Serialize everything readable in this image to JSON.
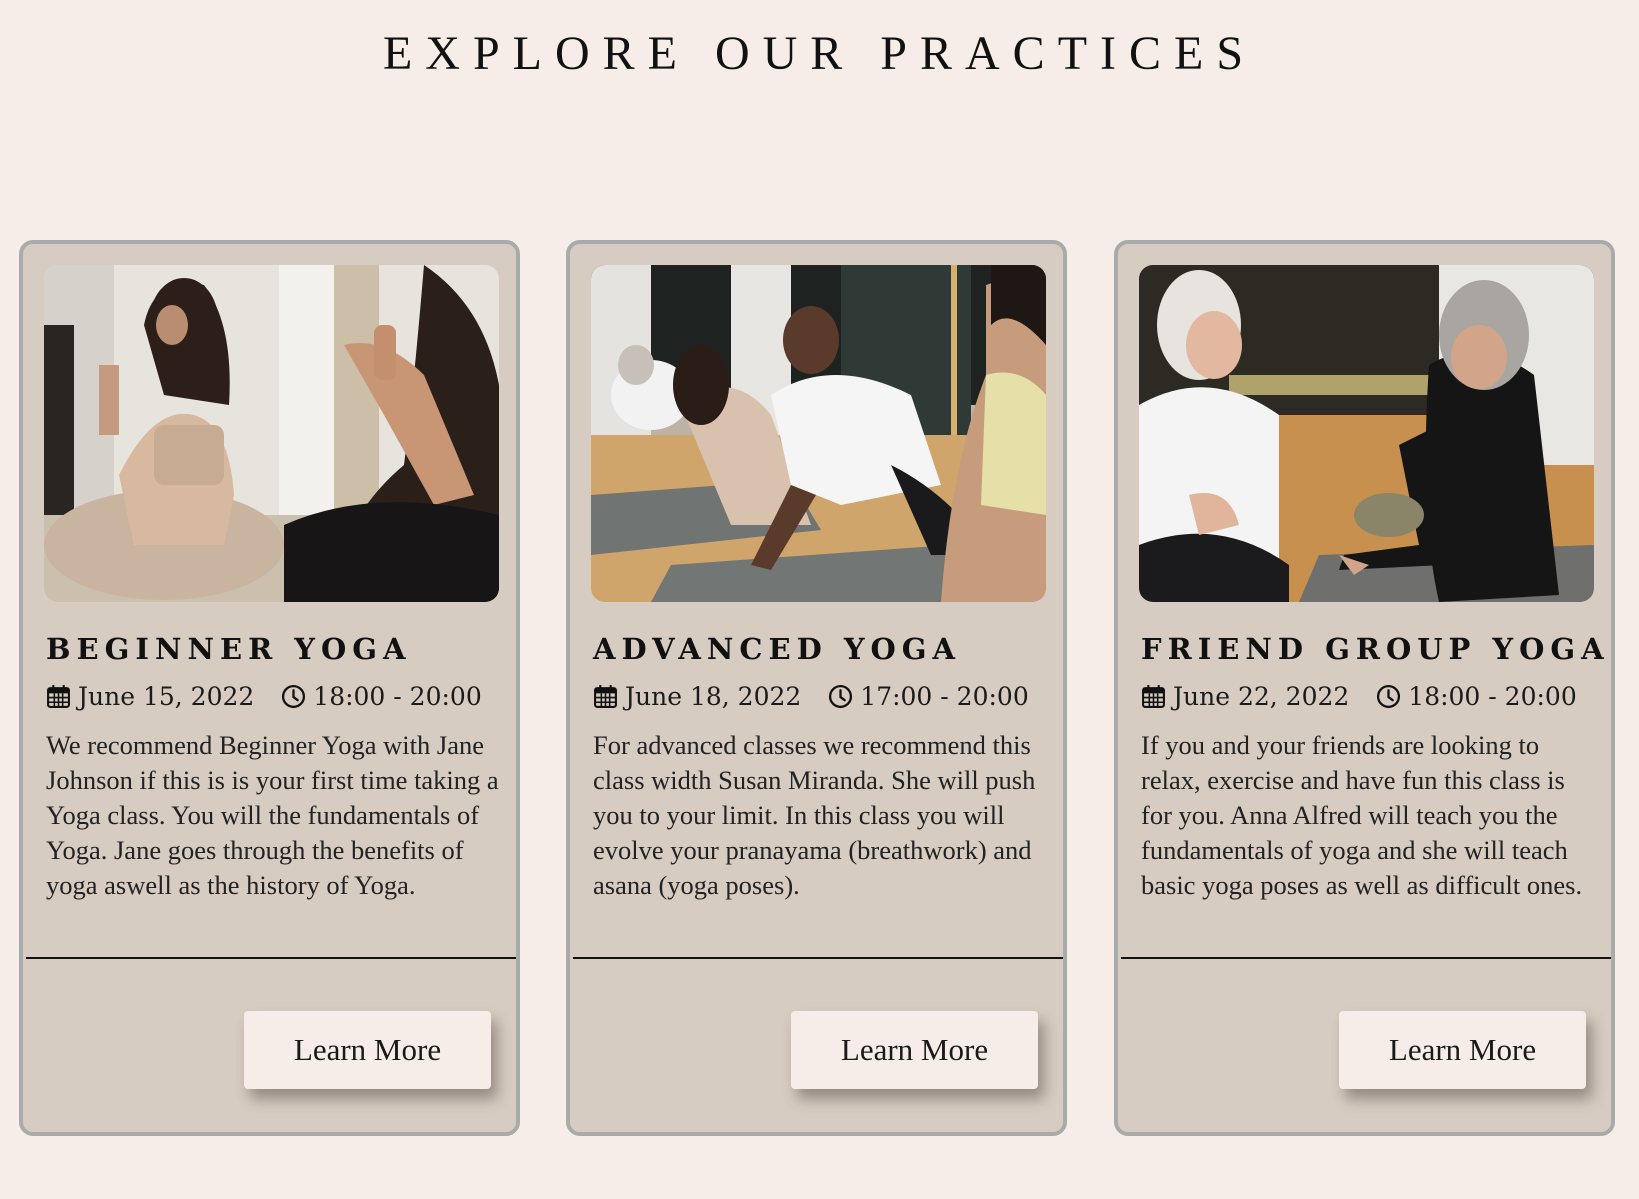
{
  "section": {
    "title": "EXPLORE OUR PRACTICES"
  },
  "cards": [
    {
      "title": "BEGINNER YOGA",
      "date": "June 15, 2022",
      "time": "18:00 - 20:00",
      "description": "We recommend Beginner Yoga with Jane Johnson if this is is your first time taking a Yoga class. You will the fundamentals of Yoga. Jane goes through the benefits of yoga aswell as the history of Yoga.",
      "button_label": "Learn More"
    },
    {
      "title": "ADVANCED YOGA",
      "date": "June 18, 2022",
      "time": "17:00 - 20:00",
      "description": "For advanced classes we recommend this class width Susan Miranda. She will push you to your limit. In this class you will evolve your pranayama (breathwork) and asana (yoga poses).",
      "button_label": "Learn More"
    },
    {
      "title": "FRIEND GROUP YOGA",
      "date": "June 22, 2022",
      "time": "18:00 - 20:00",
      "description": "If you and your friends are looking to relax, exercise and have fun this class is for you. Anna Alfred will teach you the fundamentals of yoga and she will teach basic yoga poses as well as difficult ones.",
      "button_label": "Learn More"
    }
  ],
  "icons": {
    "date": "calendar-icon",
    "time": "clock-icon"
  },
  "colors": {
    "page_background": "#f6ede8",
    "card_background": "#d7ccc1",
    "card_border": "#a9aaaa",
    "button_background": "#f6ede8",
    "text": "#1b1b1b"
  }
}
